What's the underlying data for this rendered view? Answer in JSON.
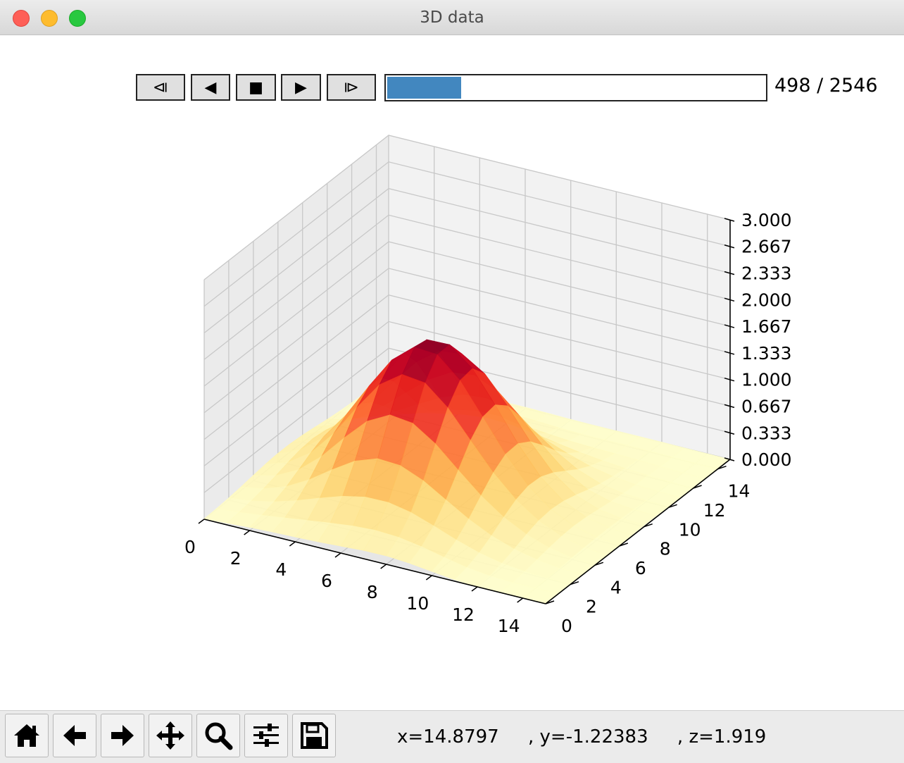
{
  "window": {
    "title": "3D data"
  },
  "animation": {
    "buttons": [
      {
        "name": "first-frame-button",
        "glyph": "⧏"
      },
      {
        "name": "play-backward-button",
        "glyph": "◀"
      },
      {
        "name": "pause-button",
        "glyph": "■"
      },
      {
        "name": "play-forward-button",
        "glyph": "▶"
      },
      {
        "name": "last-frame-button",
        "glyph": "⧐"
      }
    ],
    "progress_fraction": 0.196,
    "frame_label": "498 / 2546",
    "slider_color": "#4287bf"
  },
  "chart_data": {
    "type": "surface",
    "title": "",
    "colormap": "YlOrRd (light yellow to dark red)",
    "x_ticks": [
      "0",
      "2",
      "4",
      "6",
      "8",
      "10",
      "12",
      "14"
    ],
    "y_ticks": [
      "0",
      "2",
      "4",
      "6",
      "8",
      "10",
      "12",
      "14"
    ],
    "z_ticks": [
      "0.000",
      "0.333",
      "0.667",
      "1.000",
      "1.333",
      "1.667",
      "2.000",
      "2.333",
      "2.667",
      "3.000"
    ],
    "xlim": [
      0,
      15
    ],
    "ylim": [
      0,
      15
    ],
    "zlim": [
      0,
      3
    ],
    "grid": true,
    "peak": {
      "x": 6.5,
      "y": 6.5,
      "z": 1.9,
      "spread": 2.7
    },
    "grid_size": 16
  },
  "toolbar": {
    "buttons": [
      {
        "name": "home-button",
        "icon": "home-icon"
      },
      {
        "name": "back-button",
        "icon": "arrow-left-icon"
      },
      {
        "name": "forward-button",
        "icon": "arrow-right-icon"
      },
      {
        "name": "pan-button",
        "icon": "move-icon"
      },
      {
        "name": "zoom-button",
        "icon": "magnifier-icon"
      },
      {
        "name": "configure-subplots-button",
        "icon": "sliders-icon"
      },
      {
        "name": "save-button",
        "icon": "floppy-disk-icon"
      }
    ],
    "coordinates": "x=14.8797     , y=-1.22383     , z=1.919"
  }
}
